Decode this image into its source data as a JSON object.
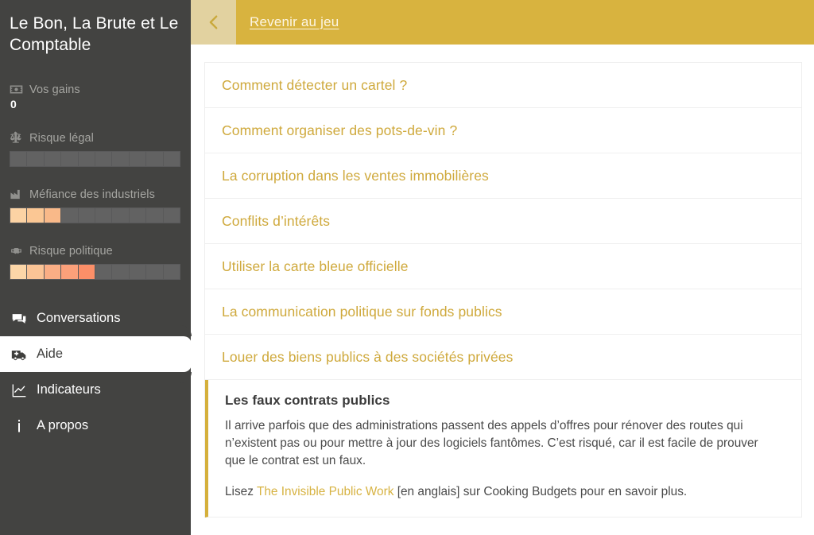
{
  "sidebar": {
    "brand": "Le Bon, La Brute et Le Comptable",
    "stats": [
      {
        "icon": "banknote-icon",
        "label": "Vos gains",
        "value": "0",
        "type": "value"
      },
      {
        "icon": "scales-icon",
        "label": "Risque légal",
        "type": "meter",
        "segments": 10,
        "filled": 0,
        "colors": []
      },
      {
        "icon": "factory-icon",
        "label": "Méfiance des industriels",
        "type": "meter",
        "segments": 10,
        "filled": 3,
        "colors": [
          "#fcd3a4",
          "#fbc794",
          "#f9b989"
        ]
      },
      {
        "icon": "handshake-icon",
        "label": "Risque politique",
        "type": "meter",
        "segments": 10,
        "filled": 5,
        "colors": [
          "#fcd6a8",
          "#fbc496",
          "#faae85",
          "#fba07a",
          "#fc8f68"
        ]
      }
    ],
    "nav": [
      {
        "icon": "chat-icon",
        "label": "Conversations",
        "active": false
      },
      {
        "icon": "ambulance-icon",
        "label": "Aide",
        "active": true
      },
      {
        "icon": "chart-line-icon",
        "label": "Indicateurs",
        "active": false
      },
      {
        "icon": "info-icon",
        "label": "A propos",
        "active": false
      }
    ]
  },
  "topbar": {
    "back_icon": "chevron-left-icon",
    "back_label": "Revenir au jeu"
  },
  "faq": {
    "items": [
      "Comment détecter un cartel ?",
      "Comment organiser des pots-de-vin ?",
      "La corruption dans les ventes immobilières",
      "Conflits d’intérêts",
      "Utiliser la carte bleue officielle",
      "La communication politique sur fonds publics",
      "Louer des biens publics à des sociétés privées"
    ],
    "expanded": {
      "title": "Les faux contrats publics",
      "body": "Il arrive parfois que des administrations passent des appels d’offres pour rénover des routes qui n’existent pas ou pour mettre à jour des logiciels fantômes. C’est risqué, car il est facile de prouver que le contrat est un faux.",
      "read_prefix": "Lisez ",
      "read_link": "The Invisible Public Work",
      "read_suffix": " [en anglais] sur Cooking Budgets pour en savoir plus."
    }
  },
  "colors": {
    "sidebar_bg": "#434341",
    "topbar_gold": "#d8b33f",
    "back_btn_gold": "#e2d2a0",
    "link_gold": "#cfa93c",
    "accent_bar": "#d5b03c"
  }
}
